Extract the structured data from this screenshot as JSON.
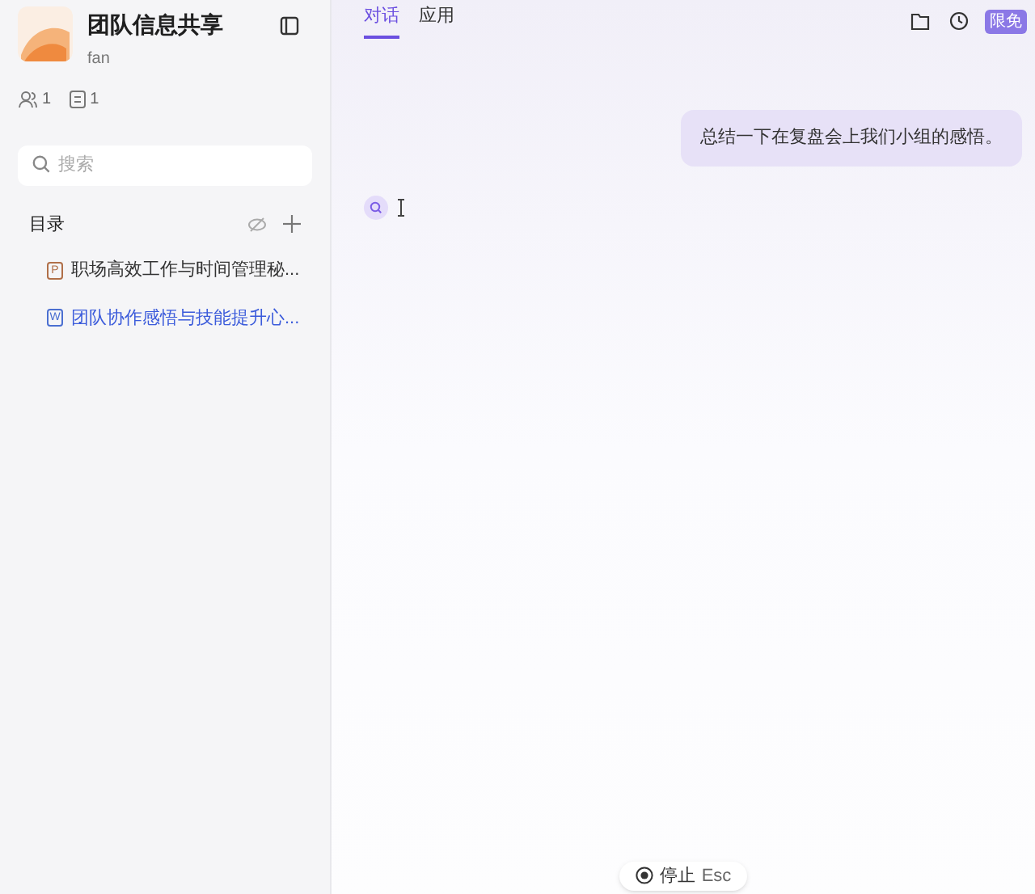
{
  "workspace": {
    "title": "团队信息共享",
    "owner": "fan",
    "members": "1",
    "documents": "1"
  },
  "search": {
    "placeholder": "搜索"
  },
  "catalog": {
    "title": "目录",
    "items": [
      {
        "kind": "ppt",
        "letter": "P",
        "label": "职场高效工作与时间管理秘...",
        "selected": false
      },
      {
        "kind": "word",
        "letter": "W",
        "label": "团队协作感悟与技能提升心...",
        "selected": true
      }
    ]
  },
  "tabs": [
    {
      "label": "对话",
      "selected": true
    },
    {
      "label": "应用",
      "selected": false
    }
  ],
  "badge": "限免",
  "user_message": "总结一下在复盘会上我们小组的感悟。",
  "stop_button": {
    "label": "停止",
    "key": "Esc"
  }
}
